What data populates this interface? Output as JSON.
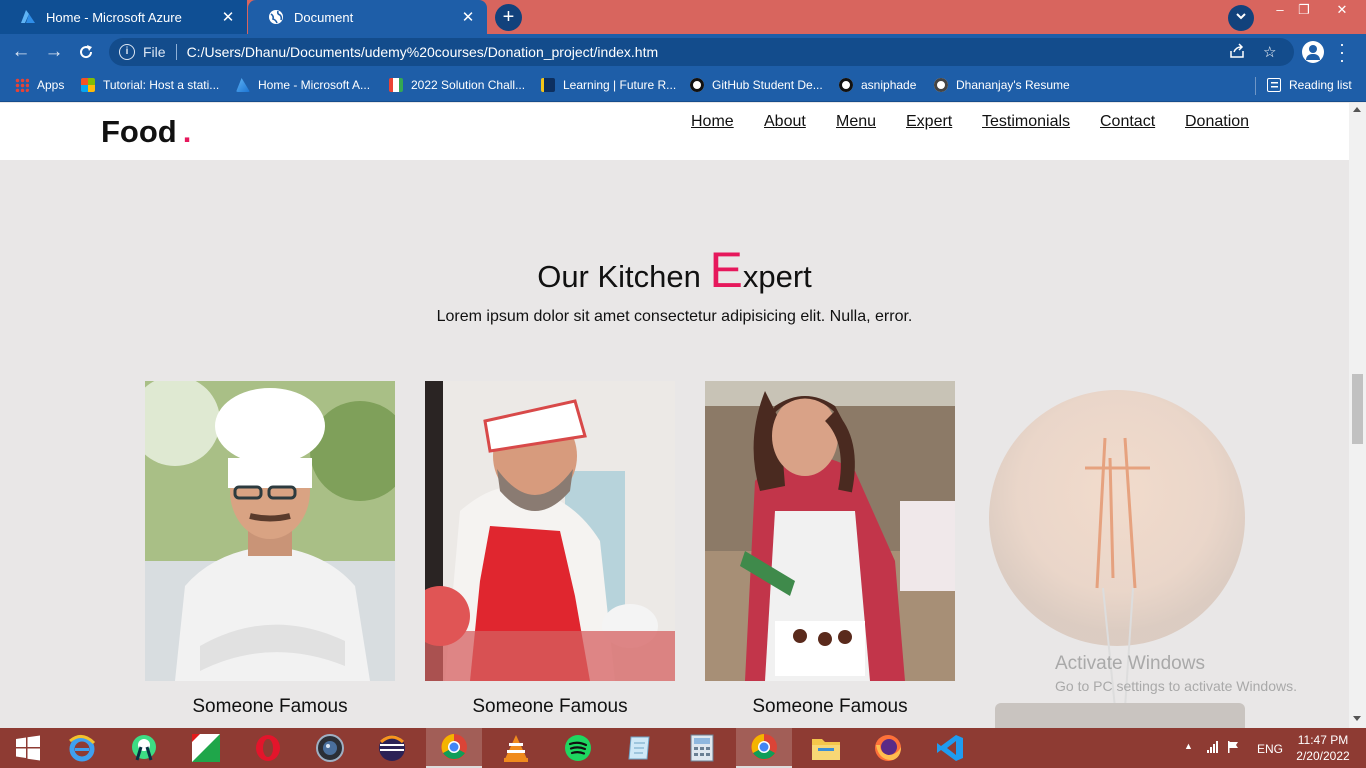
{
  "browser": {
    "tabs": [
      {
        "title": "Home - Microsoft Azure",
        "active": false
      },
      {
        "title": "Document",
        "active": true
      }
    ],
    "address": {
      "scheme_label": "File",
      "url": "C:/Users/Dhanu/Documents/udemy%20courses/Donation_project/index.htm"
    },
    "bookmarks": [
      {
        "label": "Apps",
        "icon": "apps-grid-icon"
      },
      {
        "label": "Tutorial: Host a stati...",
        "icon": "microsoft-icon"
      },
      {
        "label": "Home - Microsoft A...",
        "icon": "azure-icon"
      },
      {
        "label": "2022 Solution Chall...",
        "icon": "gdsc-icon"
      },
      {
        "label": "Learning | Future R...",
        "icon": "learning-icon"
      },
      {
        "label": "GitHub Student De...",
        "icon": "github-icon"
      },
      {
        "label": "asniphade",
        "icon": "github-icon"
      },
      {
        "label": "Dhananjay's Resume",
        "icon": "globe-icon"
      }
    ],
    "reading_list": "Reading list"
  },
  "site": {
    "logo": "Food",
    "logo_dot": ".",
    "nav": [
      "Home",
      "About",
      "Menu",
      "Expert",
      "Testimonials",
      "Contact",
      "Donation"
    ],
    "section": {
      "title_pre": "Our Kitchen ",
      "title_big": "E",
      "title_post": "xpert",
      "subtitle": "Lorem ipsum dolor sit amet consectetur adipisicing elit. Nulla, error."
    },
    "experts": [
      {
        "name": "Someone Famous",
        "photo": "chef-arms-crossed-photo"
      },
      {
        "name": "Someone Famous",
        "photo": "chef-red-apron-photo"
      },
      {
        "name": "Someone Famous",
        "photo": "woman-baker-photo"
      }
    ],
    "accent": "#e6185c"
  },
  "watermark": {
    "line1": "Activate Windows",
    "line2": "Go to PC settings to activate Windows."
  },
  "taskbar": {
    "apps": [
      "start",
      "internet-explorer",
      "android-studio",
      "shree",
      "opera",
      "camera",
      "eclipse",
      "chrome",
      "vlc",
      "spotify",
      "notepad",
      "calculator",
      "chrome",
      "file-explorer",
      "firefox",
      "vscode"
    ],
    "language": "ENG",
    "time": "11:47 PM",
    "date": "2/20/2022"
  }
}
